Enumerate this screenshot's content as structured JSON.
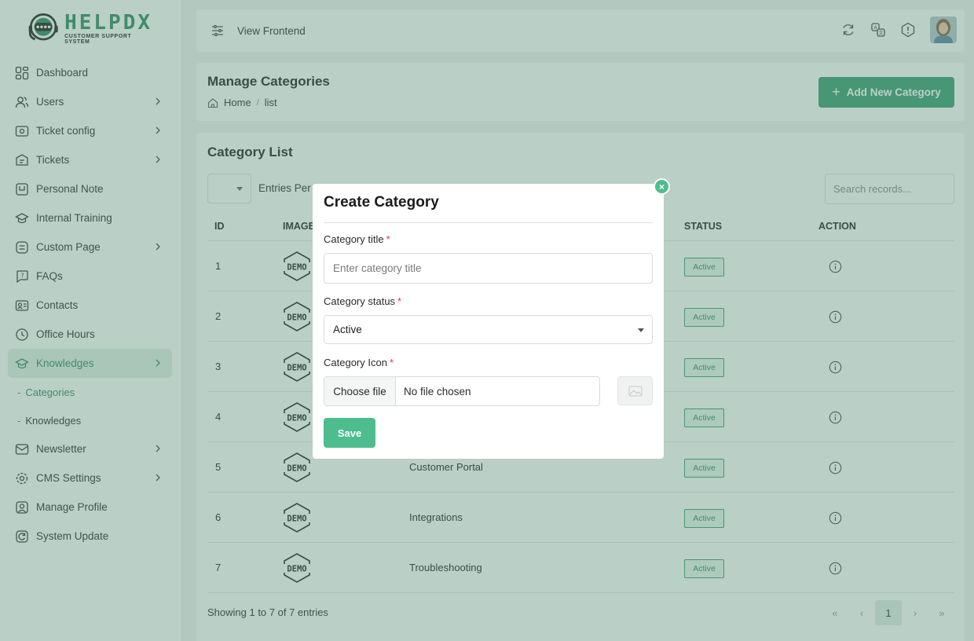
{
  "brand": {
    "name": "HELPDX",
    "tagline": "CUSTOMER SUPPORT SYSTEM",
    "color": "#2e8b64"
  },
  "sidebar": {
    "items": [
      {
        "label": "Dashboard",
        "icon": "dashboard-icon",
        "has_children": false
      },
      {
        "label": "Users",
        "icon": "users-icon",
        "has_children": true
      },
      {
        "label": "Ticket config",
        "icon": "ticket-config-icon",
        "has_children": true
      },
      {
        "label": "Tickets",
        "icon": "tickets-icon",
        "has_children": true
      },
      {
        "label": "Personal Note",
        "icon": "note-icon",
        "has_children": false
      },
      {
        "label": "Internal Training",
        "icon": "training-icon",
        "has_children": false
      },
      {
        "label": "Custom Page",
        "icon": "page-icon",
        "has_children": true
      },
      {
        "label": "FAQs",
        "icon": "faq-icon",
        "has_children": false
      },
      {
        "label": "Contacts",
        "icon": "contacts-icon",
        "has_children": false
      },
      {
        "label": "Office Hours",
        "icon": "clock-icon",
        "has_children": false
      },
      {
        "label": "Knowledges",
        "icon": "knowledge-icon",
        "has_children": true,
        "active": true
      },
      {
        "label": "Newsletter",
        "icon": "newsletter-icon",
        "has_children": true
      },
      {
        "label": "CMS Settings",
        "icon": "settings-icon",
        "has_children": true
      },
      {
        "label": "Manage Profile",
        "icon": "profile-icon",
        "has_children": false
      },
      {
        "label": "System Update",
        "icon": "update-icon",
        "has_children": false
      }
    ],
    "subitems": [
      {
        "label": "Categories",
        "active": true
      },
      {
        "label": "Knowledges",
        "active": false
      }
    ]
  },
  "topbar": {
    "view_frontend": "View Frontend"
  },
  "header": {
    "title": "Manage Categories",
    "breadcrumb_home": "Home",
    "breadcrumb_sep": "/",
    "breadcrumb_current": "list",
    "add_button": "Add New Category",
    "add_plus": "+"
  },
  "card": {
    "title": "Category List",
    "entries_label": "Entries Per",
    "search_placeholder": "Search records...",
    "columns": {
      "id": "ID",
      "image": "IMAGE",
      "status": "STATUS",
      "action": "ACTION"
    },
    "rows": [
      {
        "id": "1",
        "title": "",
        "status": "Active"
      },
      {
        "id": "2",
        "title": "",
        "status": "Active"
      },
      {
        "id": "3",
        "title": "",
        "status": "Active"
      },
      {
        "id": "4",
        "title": "",
        "status": "Active"
      },
      {
        "id": "5",
        "title": "Customer Portal",
        "status": "Active"
      },
      {
        "id": "6",
        "title": "Integrations",
        "status": "Active"
      },
      {
        "id": "7",
        "title": "Troubleshooting",
        "status": "Active"
      }
    ],
    "demo_logo_text": "DEMO",
    "showing": "Showing 1 to 7 of 7 entries",
    "pager": {
      "first": "«",
      "prev": "‹",
      "current": "1",
      "next": "›",
      "last": "»"
    }
  },
  "modal": {
    "title": "Create Category",
    "close": "×",
    "title_label": "Category title",
    "title_placeholder": "Enter category title",
    "status_label": "Category status",
    "status_value": "Active",
    "icon_label": "Category Icon",
    "file_button": "Choose file",
    "file_name": "No file chosen",
    "required_mark": "*",
    "save": "Save"
  },
  "colors": {
    "accent": "#3a9e72",
    "accent_light": "#4dbd8e",
    "required": "#e0383e",
    "overlay": "rgba(90,140,118,0.42)"
  }
}
